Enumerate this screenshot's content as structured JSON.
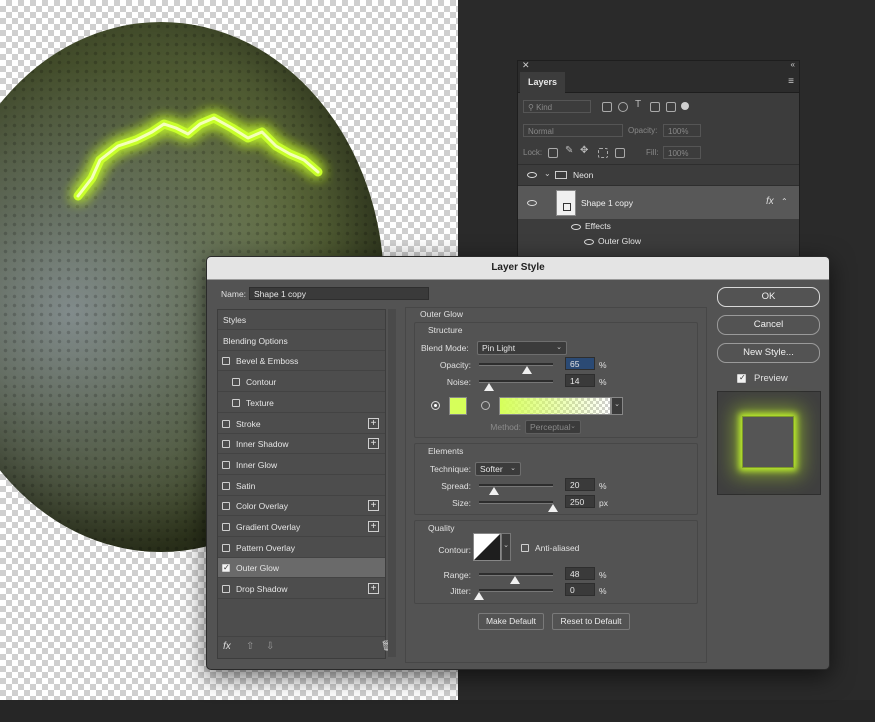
{
  "layers_panel": {
    "tab_label": "Layers",
    "kind_placeholder": "Kind",
    "blend_mode": "Normal",
    "opacity_label": "Opacity:",
    "opacity_value": "100%",
    "lock_label": "Lock:",
    "fill_label": "Fill:",
    "fill_value": "100%",
    "group_name": "Neon",
    "layer_name": "Shape 1 copy",
    "fx_label": "fx",
    "effects_label": "Effects",
    "effect_item": "Outer Glow"
  },
  "dialog": {
    "title": "Layer Style",
    "name_label": "Name:",
    "name_value": "Shape 1 copy",
    "styles": [
      {
        "label": "Styles",
        "checkbox": false,
        "checked": false,
        "plus": false,
        "indent": false
      },
      {
        "label": "Blending Options",
        "checkbox": false,
        "checked": false,
        "plus": false,
        "indent": false
      },
      {
        "label": "Bevel & Emboss",
        "checkbox": true,
        "checked": false,
        "plus": false,
        "indent": false
      },
      {
        "label": "Contour",
        "checkbox": true,
        "checked": false,
        "plus": false,
        "indent": true
      },
      {
        "label": "Texture",
        "checkbox": true,
        "checked": false,
        "plus": false,
        "indent": true
      },
      {
        "label": "Stroke",
        "checkbox": true,
        "checked": false,
        "plus": true,
        "indent": false
      },
      {
        "label": "Inner Shadow",
        "checkbox": true,
        "checked": false,
        "plus": true,
        "indent": false
      },
      {
        "label": "Inner Glow",
        "checkbox": true,
        "checked": false,
        "plus": false,
        "indent": false
      },
      {
        "label": "Satin",
        "checkbox": true,
        "checked": false,
        "plus": false,
        "indent": false
      },
      {
        "label": "Color Overlay",
        "checkbox": true,
        "checked": false,
        "plus": true,
        "indent": false
      },
      {
        "label": "Gradient Overlay",
        "checkbox": true,
        "checked": false,
        "plus": true,
        "indent": false
      },
      {
        "label": "Pattern Overlay",
        "checkbox": true,
        "checked": false,
        "plus": false,
        "indent": false
      },
      {
        "label": "Outer Glow",
        "checkbox": true,
        "checked": true,
        "plus": false,
        "indent": false,
        "selected": true
      },
      {
        "label": "Drop Shadow",
        "checkbox": true,
        "checked": false,
        "plus": true,
        "indent": false
      }
    ],
    "fx_footer": "fx",
    "section_title": "Outer Glow",
    "structure": {
      "title": "Structure",
      "blend_mode_label": "Blend Mode:",
      "blend_mode_value": "Pin Light",
      "opacity_label": "Opacity:",
      "opacity_value": "65",
      "opacity_fraction": 0.65,
      "noise_label": "Noise:",
      "noise_value": "14",
      "noise_fraction": 0.14,
      "percent_unit": "%",
      "glow_color": "#d6ff5a",
      "method_label": "Method:",
      "method_value": "Perceptual"
    },
    "elements": {
      "title": "Elements",
      "technique_label": "Technique:",
      "technique_value": "Softer",
      "spread_label": "Spread:",
      "spread_value": "20",
      "spread_fraction": 0.2,
      "size_label": "Size:",
      "size_value": "250",
      "size_fraction": 1.0,
      "px_unit": "px"
    },
    "quality": {
      "title": "Quality",
      "contour_label": "Contour:",
      "anti_aliased_label": "Anti-aliased",
      "range_label": "Range:",
      "range_value": "48",
      "range_fraction": 0.48,
      "jitter_label": "Jitter:",
      "jitter_value": "0",
      "jitter_fraction": 0.0
    },
    "make_default_label": "Make Default",
    "reset_default_label": "Reset to Default",
    "ok_label": "OK",
    "cancel_label": "Cancel",
    "new_style_label": "New Style...",
    "preview_label": "Preview"
  },
  "colors": {
    "neon": "#c8ff2a",
    "dialog_bg": "#535353"
  }
}
